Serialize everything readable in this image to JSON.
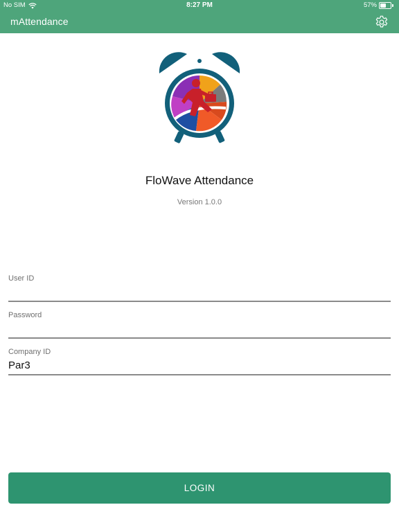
{
  "status_bar": {
    "carrier": "No SIM",
    "time": "8:27 PM",
    "battery_percent": "57%",
    "battery_level": 0.57,
    "icons": [
      "wifi-icon",
      "battery-icon"
    ]
  },
  "app_bar": {
    "title": "mAttendance",
    "settings_icon": "gear-icon",
    "background_color": "#4ea57b"
  },
  "branding": {
    "logo_icon": "alarm-clock-logo-icon",
    "app_name": "FloWave Attendance",
    "version": "Version 1.0.0"
  },
  "form": {
    "fields": [
      {
        "label": "User ID",
        "value": "",
        "placeholder": ""
      },
      {
        "label": "Password",
        "value": "",
        "placeholder": ""
      },
      {
        "label": "Company ID",
        "value": "Par3",
        "placeholder": ""
      }
    ]
  },
  "login": {
    "label": "LOGIN",
    "color": "#2e9470"
  }
}
